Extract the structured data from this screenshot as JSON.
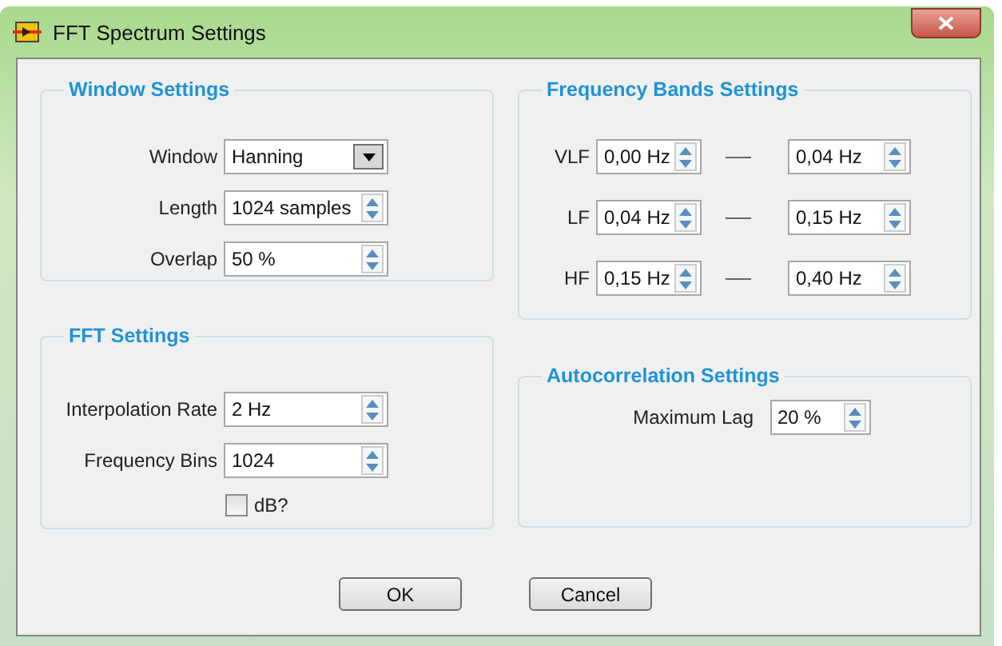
{
  "window": {
    "title": "FFT Spectrum Settings"
  },
  "window_settings": {
    "title": "Window Settings",
    "fields": [
      {
        "label": "Window",
        "value": "Hanning",
        "kind": "dropdown"
      },
      {
        "label": "Length",
        "value": "1024 samples",
        "kind": "spinner"
      },
      {
        "label": "Overlap",
        "value": "50 %",
        "kind": "spinner"
      }
    ]
  },
  "fft_settings": {
    "title": "FFT Settings",
    "fields": [
      {
        "label": "Interpolation Rate",
        "value": "2 Hz",
        "kind": "spinner"
      },
      {
        "label": "Frequency Bins",
        "value": "1024",
        "kind": "spinner"
      }
    ],
    "checkbox": {
      "label": "dB?",
      "checked": false
    }
  },
  "frequency_bands": {
    "title": "Frequency Bands Settings",
    "bands": [
      {
        "label": "VLF",
        "low": "0,00 Hz",
        "high": "0,04 Hz"
      },
      {
        "label": "LF",
        "low": "0,04 Hz",
        "high": "0,15 Hz"
      },
      {
        "label": "HF",
        "low": "0,15 Hz",
        "high": "0,40 Hz"
      }
    ]
  },
  "autocorrelation": {
    "title": "Autocorrelation Settings",
    "fields": [
      {
        "label": "Maximum Lag",
        "value": "20 %",
        "kind": "spinner"
      }
    ]
  },
  "buttons": [
    "OK",
    "Cancel"
  ]
}
